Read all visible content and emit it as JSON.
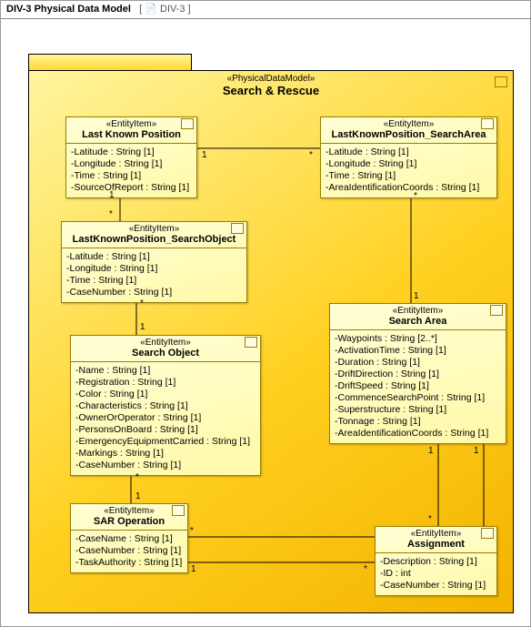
{
  "tab": {
    "title": "DIV-3 Physical Data Model",
    "stereotype_label": "DIV-3",
    "bracket_open": "[",
    "bracket_close": "]"
  },
  "package": {
    "stereotype": "«PhysicalDataModel»",
    "name": "Search & Rescue"
  },
  "entities": {
    "lkp": {
      "stereo": "«EntityItem»",
      "name": "Last Known Position",
      "attrs": [
        "-Latitude : String [1]",
        "-Longitude : String [1]",
        "-Time : String [1]",
        "-SourceOfReport : String [1]"
      ]
    },
    "lkp_sa": {
      "stereo": "«EntityItem»",
      "name": "LastKnownPosition_SearchArea",
      "attrs": [
        "-Latitude : String [1]",
        "-Longitude : String [1]",
        "-Time : String [1]",
        "-AreaIdentificationCoords : String [1]"
      ]
    },
    "lkp_so": {
      "stereo": "«EntityItem»",
      "name": "LastKnownPosition_SearchObject",
      "attrs": [
        "-Latitude : String [1]",
        "-Longitude : String [1]",
        "-Time : String [1]",
        "-CaseNumber : String [1]"
      ]
    },
    "sa": {
      "stereo": "«EntityItem»",
      "name": "Search Area",
      "attrs": [
        "-Waypoints : String [2..*]",
        "-ActivationTime : String [1]",
        "-Duration : String [1]",
        "-DriftDirection : String [1]",
        "-DriftSpeed : String [1]",
        "-CommenceSearchPoint : String [1]",
        "-Superstructure : String [1]",
        "-Tonnage : String [1]",
        "-AreaIdentificationCoords : String [1]"
      ]
    },
    "so": {
      "stereo": "«EntityItem»",
      "name": "Search Object",
      "attrs": [
        "-Name : String [1]",
        "-Registration : String [1]",
        "-Color : String [1]",
        "-Characteristics : String [1]",
        "-OwnerOrOperator : String [1]",
        "-PersonsOnBoard : String [1]",
        "-EmergencyEquipmentCarried : String [1]",
        "-Markings : String [1]",
        "-CaseNumber : String [1]"
      ]
    },
    "sar": {
      "stereo": "«EntityItem»",
      "name": "SAR Operation",
      "attrs": [
        "-CaseName : String [1]",
        "-CaseNumber : String [1]",
        "-TaskAuthority : String [1]"
      ]
    },
    "asg": {
      "stereo": "«EntityItem»",
      "name": "Assignment",
      "attrs": [
        "-Description : String [1]",
        "-ID : int",
        "-CaseNumber : String [1]"
      ]
    }
  },
  "mult": {
    "one": "1",
    "star": "*"
  }
}
